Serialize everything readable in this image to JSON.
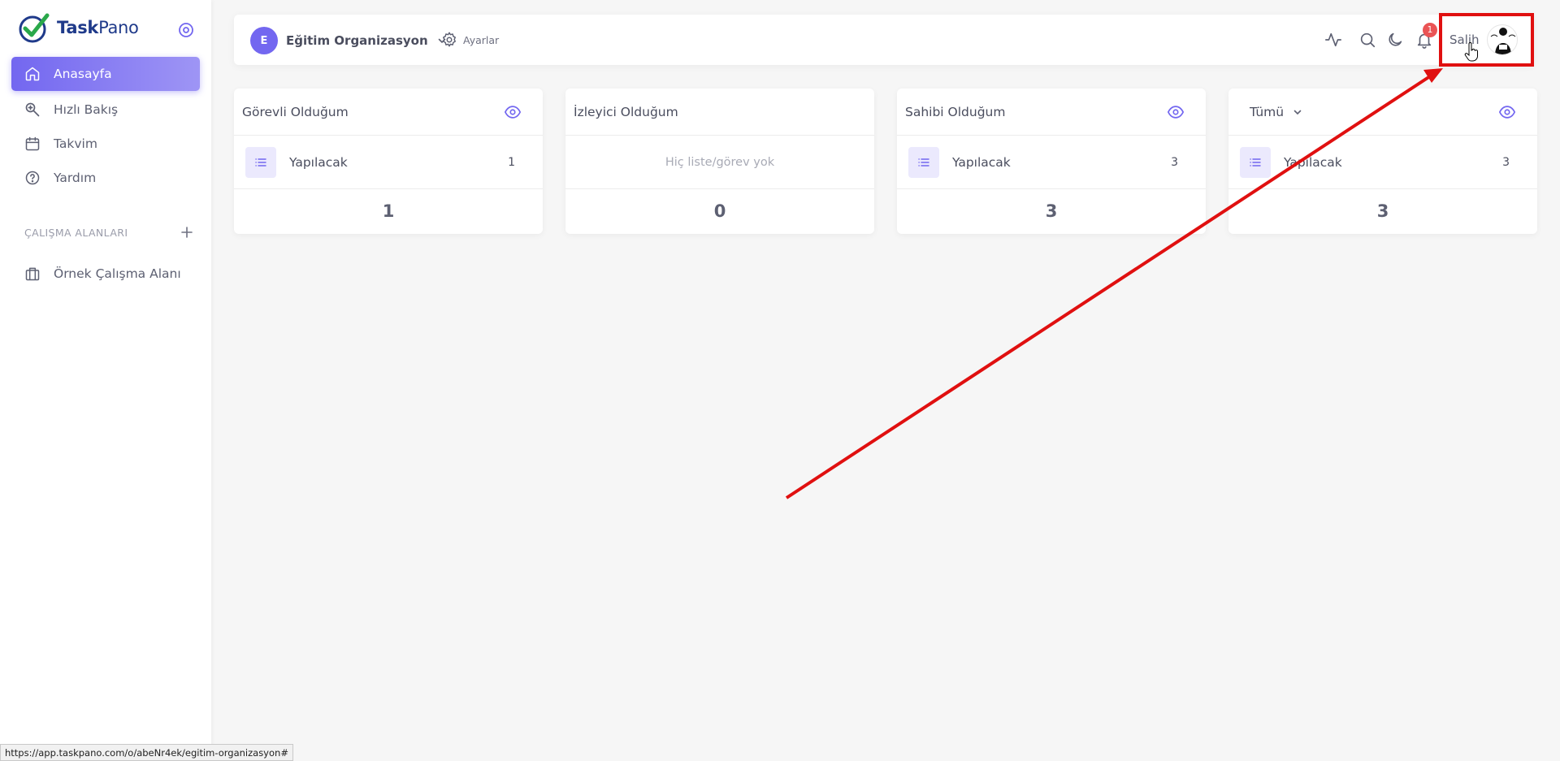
{
  "app": {
    "logo_prefix": "Task",
    "logo_suffix": "Pano"
  },
  "sidebar": {
    "items": [
      {
        "label": "Anasayfa",
        "icon": "home-icon",
        "active": true
      },
      {
        "label": "Hızlı Bakış",
        "icon": "zoom-icon",
        "active": false
      },
      {
        "label": "Takvim",
        "icon": "calendar-icon",
        "active": false
      },
      {
        "label": "Yardım",
        "icon": "help-circle-icon",
        "active": false
      }
    ],
    "section_title": "ÇALIŞMA ALANLARI",
    "workspaces": [
      {
        "label": "Örnek Çalışma Alanı",
        "icon": "briefcase-icon"
      }
    ]
  },
  "topbar": {
    "org_initial": "E",
    "org_name": "Eğitim Organizasyon",
    "settings_label": "Ayarlar",
    "notification_count": "1",
    "user_name": "Salih"
  },
  "cards": [
    {
      "title": "Görevli Olduğum",
      "row_label": "Yapılacak",
      "row_count": "1",
      "total": "1"
    },
    {
      "title": "İzleyici Olduğum",
      "empty_text": "Hiç liste/görev yok",
      "total": "0"
    },
    {
      "title": "Sahibi Olduğum",
      "row_label": "Yapılacak",
      "row_count": "3",
      "total": "3"
    },
    {
      "title": "Tümü",
      "row_label": "Yapılacak",
      "row_count": "3",
      "total": "3"
    }
  ],
  "statusbar": {
    "url": "https://app.taskpano.com/o/abeNr4ek/egitim-organizasyon#"
  },
  "colors": {
    "accent": "#7367f0",
    "annotation": "#e01010",
    "badge": "#ea5455"
  }
}
